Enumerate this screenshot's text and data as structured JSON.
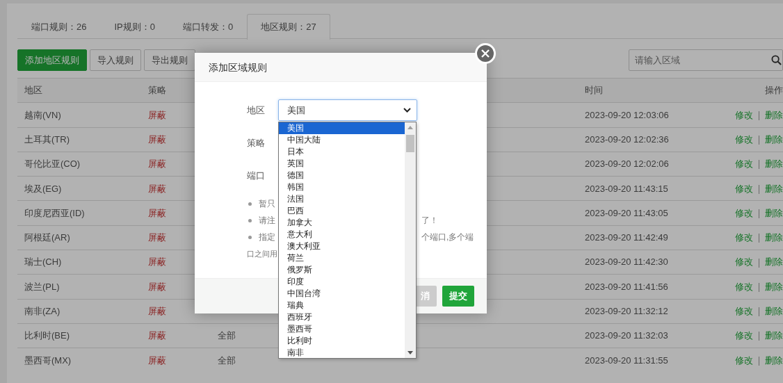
{
  "tabs": [
    {
      "label": "端口规则：26",
      "selected": false
    },
    {
      "label": "IP规则：0",
      "selected": false
    },
    {
      "label": "端口转发：0",
      "selected": false
    },
    {
      "label": "地区规则：27",
      "selected": true
    }
  ],
  "toolbar": {
    "buttons": [
      {
        "label": "添加地区规则",
        "kind": "primary"
      },
      {
        "label": "导入规则",
        "kind": "default"
      },
      {
        "label": "导出规则",
        "kind": "default"
      }
    ]
  },
  "search": {
    "placeholder": "请输入区域"
  },
  "table": {
    "columns": {
      "region": "地区",
      "policy": "策略",
      "time": "时间",
      "actions": "操作"
    },
    "rows": [
      {
        "region": "越南(VN)",
        "policy": "屏蔽",
        "time": "2023-09-20 12:03:06",
        "actions": [
          "修改",
          "删除"
        ]
      },
      {
        "region": "土耳其(TR)",
        "policy": "屏蔽",
        "time": "2023-09-20 12:02:36",
        "actions": [
          "修改",
          "删除"
        ]
      },
      {
        "region": "哥伦比亚(CO)",
        "policy": "屏蔽",
        "time": "2023-09-20 12:02:06",
        "actions": [
          "修改",
          "删除"
        ]
      },
      {
        "region": "埃及(EG)",
        "policy": "屏蔽",
        "time": "2023-09-20 11:43:15",
        "actions": [
          "修改",
          "删除"
        ]
      },
      {
        "region": "印度尼西亚(ID)",
        "policy": "屏蔽",
        "time": "2023-09-20 11:43:05",
        "actions": [
          "修改",
          "删除"
        ]
      },
      {
        "region": "阿根廷(AR)",
        "policy": "屏蔽",
        "time": "2023-09-20 11:42:49",
        "actions": [
          "修改",
          "删除"
        ]
      },
      {
        "region": "瑞士(CH)",
        "policy": "屏蔽",
        "time": "2023-09-20 11:42:30",
        "actions": [
          "修改",
          "删除"
        ]
      },
      {
        "region": "波兰(PL)",
        "policy": "屏蔽",
        "time": "2023-09-20 11:41:56",
        "actions": [
          "修改",
          "删除"
        ]
      },
      {
        "region": "南非(ZA)",
        "policy": "屏蔽",
        "time": "2023-09-20 11:32:12",
        "actions": [
          "修改",
          "删除"
        ]
      },
      {
        "region": "比利时(BE)",
        "policy": "屏蔽",
        "port": "全部",
        "time": "2023-09-20 11:32:03",
        "actions": [
          "修改",
          "删除"
        ]
      },
      {
        "region": "墨西哥(MX)",
        "policy": "屏蔽",
        "port": "全部",
        "time": "2023-09-20 11:31:55",
        "actions": [
          "修改",
          "删除"
        ]
      }
    ]
  },
  "modal": {
    "title": "添加区域规则",
    "fields": [
      {
        "label": "地区",
        "kind": "select",
        "value": "美国",
        "expanded": true
      },
      {
        "label": "策略",
        "kind": "hidden"
      },
      {
        "label": "端口",
        "kind": "hidden"
      }
    ],
    "dropdown": {
      "options": [
        {
          "label": "美国",
          "selected": true
        },
        {
          "label": "中国大陆",
          "selected": false
        },
        {
          "label": "日本",
          "selected": false
        },
        {
          "label": "英国",
          "selected": false
        },
        {
          "label": "德国",
          "selected": false
        },
        {
          "label": "韩国",
          "selected": false
        },
        {
          "label": "法国",
          "selected": false
        },
        {
          "label": "巴西",
          "selected": false
        },
        {
          "label": "加拿大",
          "selected": false
        },
        {
          "label": "意大利",
          "selected": false
        },
        {
          "label": "澳大利亚",
          "selected": false
        },
        {
          "label": "荷兰",
          "selected": false
        },
        {
          "label": "俄罗斯",
          "selected": false
        },
        {
          "label": "印度",
          "selected": false
        },
        {
          "label": "中国台湾",
          "selected": false
        },
        {
          "label": "瑞典",
          "selected": false
        },
        {
          "label": "西班牙",
          "selected": false
        },
        {
          "label": "墨西哥",
          "selected": false
        },
        {
          "label": "比利时",
          "selected": false
        },
        {
          "label": "南非",
          "selected": false
        }
      ]
    },
    "notes": [
      {
        "left": "暂只"
      },
      {
        "left": "请注",
        "right": "了！"
      },
      {
        "left": "指定",
        "right": "个端口,多个端"
      }
    ],
    "note_continuation": "口之间用",
    "buttons": [
      {
        "label": "消",
        "kind": "cancel"
      },
      {
        "label": "提交",
        "kind": "submit"
      }
    ]
  }
}
